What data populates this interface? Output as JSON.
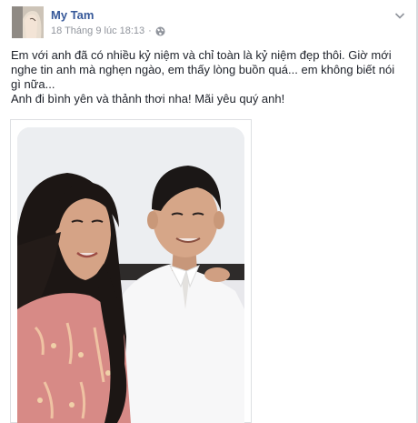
{
  "post": {
    "author": "My Tam",
    "timestamp": "18 Tháng 9 lúc 18:13",
    "separator": "·",
    "privacy_icon": "globe-icon",
    "menu_icon": "chevron-down-icon",
    "text_line1": "Em với anh đã có nhiều kỷ niệm và chỉ toàn là kỷ niệm đẹp thôi. Giờ mới nghe tin anh mà nghẹn ngào, em thấy lòng buồn quá... em không biết nói gì nữa...",
    "text_line2": "Anh đi bình yên và thảnh thơi nha! Mãi yêu quý anh!"
  },
  "colors": {
    "author_link": "#365899",
    "meta_text": "#90949c",
    "body_text": "#1d2129",
    "border": "#dddfe2"
  }
}
